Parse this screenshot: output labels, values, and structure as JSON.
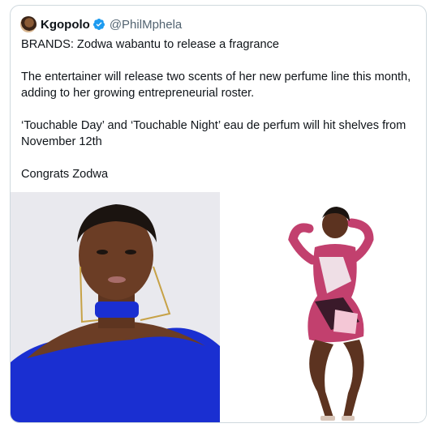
{
  "tweet": {
    "display_name": "Kgopolo",
    "handle": "@PhilMphela",
    "lines": [
      "BRANDS: Zodwa wabantu to release a fragrance",
      "The entertainer will release two scents of her new perfume line this month, adding to her growing entrepreneurial roster.",
      "‘Touchable Day’ and ‘Touchable Night’ eau de perfum will hit shelves from November 12th",
      "Congrats Zodwa"
    ]
  },
  "icons": {
    "verified": "verified-badge-icon",
    "avatar": "avatar"
  },
  "colors": {
    "verified_blue": "#1d9bf0",
    "handle_gray": "#536471",
    "border": "#cfd9de",
    "dress_blue": "#1a2fd1",
    "dress_pink": "#c2406e"
  }
}
